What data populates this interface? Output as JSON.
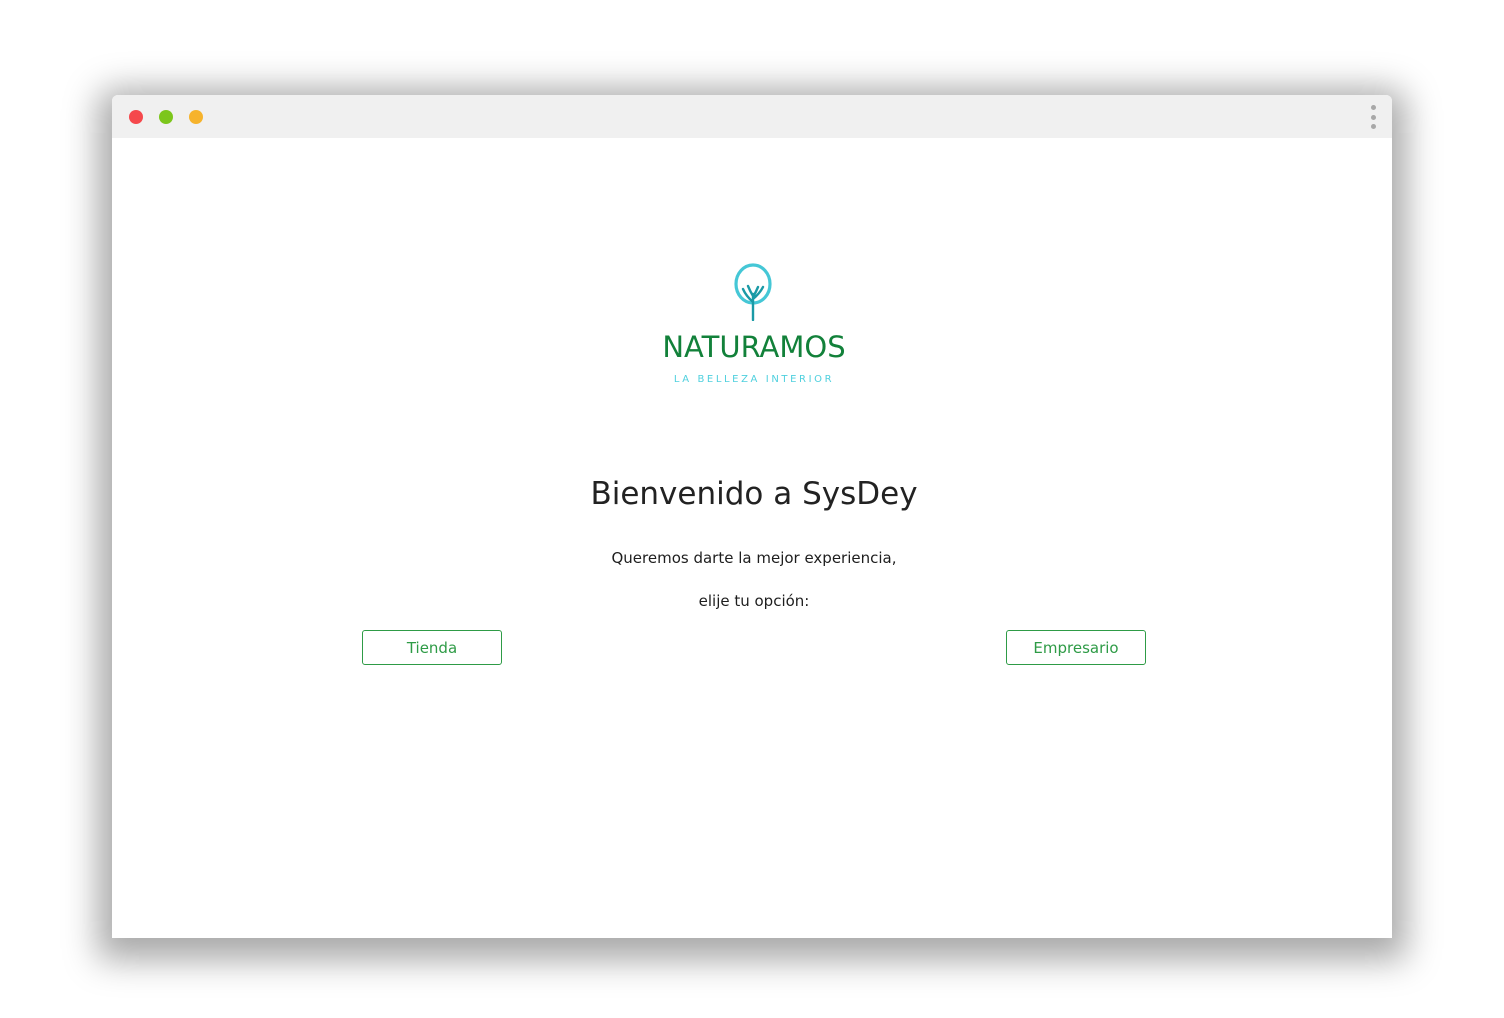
{
  "window_controls": {
    "close_color": "#f5484c",
    "minimize_color": "#7cc61b",
    "maximize_color": "#f6b32c"
  },
  "menu": {
    "icon": "kebab-vertical-icon"
  },
  "brand": {
    "icon": "tree-icon",
    "name": "NATURAMOS",
    "tagline": "LA BELLEZA INTERIOR",
    "name_color": "#12813a",
    "tagline_color": "#4fd0de",
    "icon_color": "#45c7d6",
    "icon_trunk_color": "#1a9aa6"
  },
  "welcome": {
    "title": "Bienvenido a SysDey",
    "line1": "Queremos darte la mejor experiencia,",
    "line2": "elije tu opción:"
  },
  "options": {
    "tienda_label": "Tienda",
    "empresario_label": "Empresario",
    "accent_color": "#2e9b46"
  }
}
